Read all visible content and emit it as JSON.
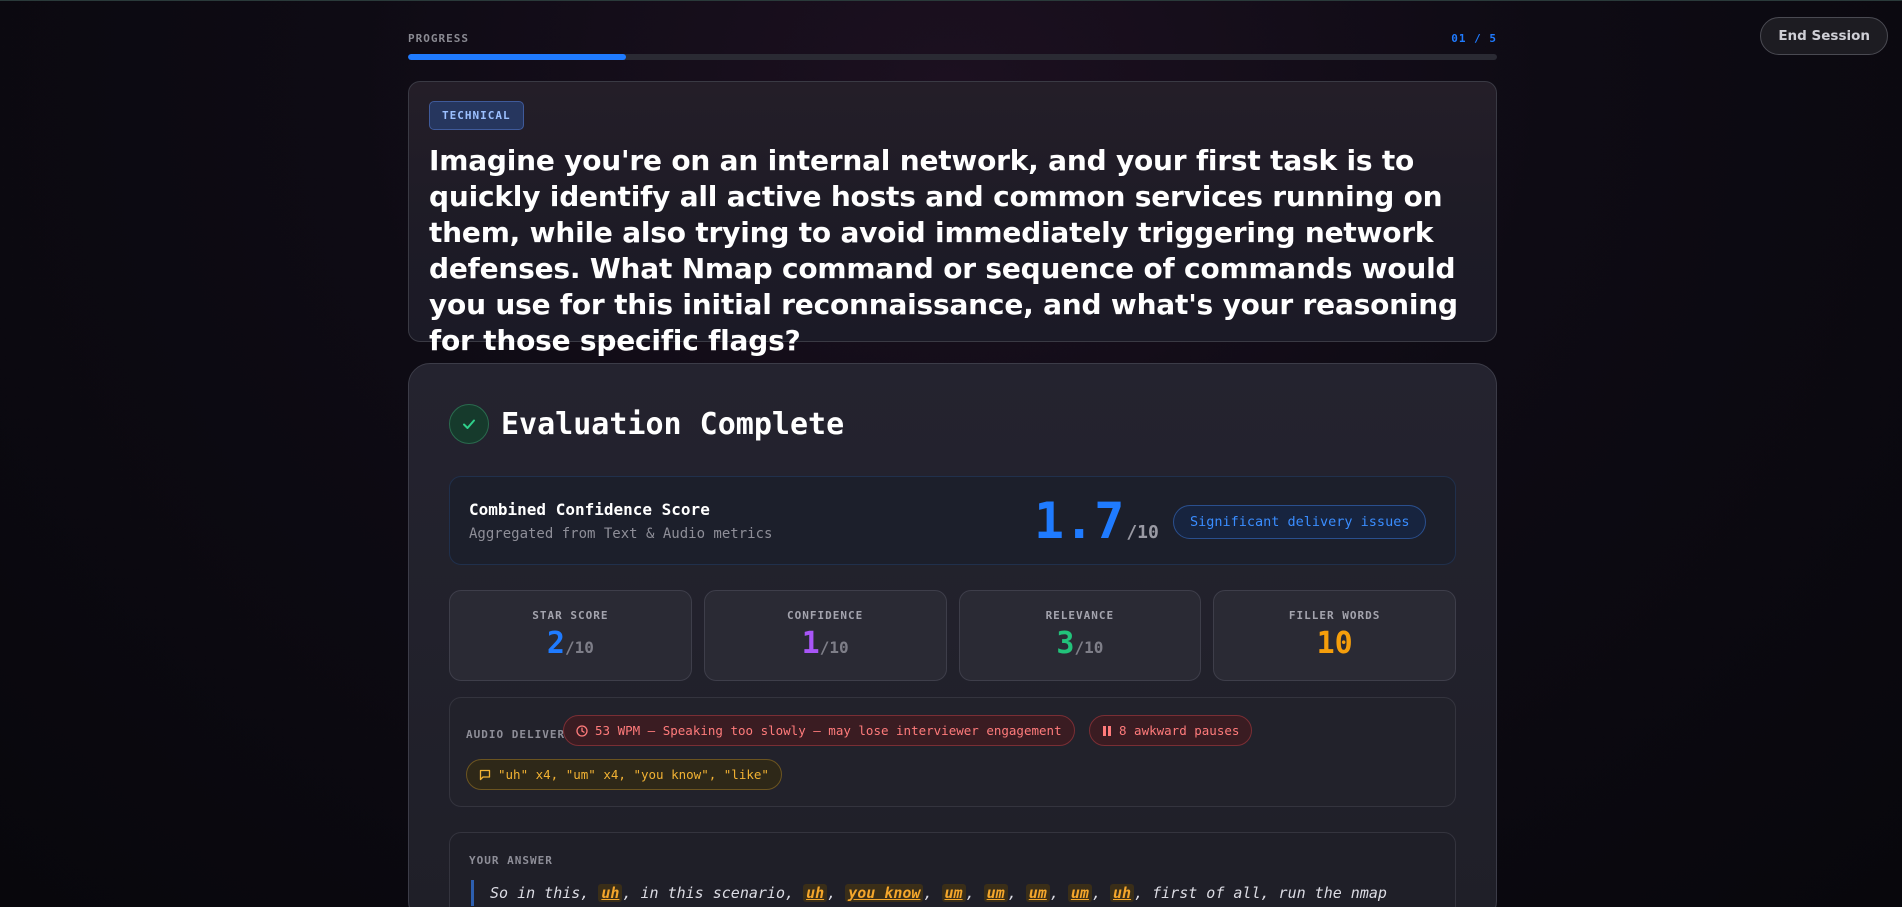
{
  "header": {
    "end_session_label": "End Session"
  },
  "progress": {
    "label": "PROGRESS",
    "count": "01 / 5",
    "fraction": 0.2
  },
  "question": {
    "tag": "TECHNICAL",
    "text": "Imagine you're on an internal network, and your first task is to quickly identify all active hosts and common services running on them, while also trying to avoid immediately triggering network defenses. What Nmap command or sequence of commands would you use for this initial reconnaissance, and what's your reasoning for those specific flags?"
  },
  "evaluation": {
    "title": "Evaluation Complete",
    "combined": {
      "title": "Combined Confidence Score",
      "subtitle": "Aggregated from Text & Audio metrics",
      "score": "1.7",
      "denominator": "/10",
      "badge": "Significant delivery issues"
    },
    "metrics": [
      {
        "label": "STAR SCORE",
        "value": "2",
        "denominator": "/10",
        "color": "#1f7bff"
      },
      {
        "label": "CONFIDENCE",
        "value": "1",
        "denominator": "/10",
        "color": "#a855f7"
      },
      {
        "label": "RELEVANCE",
        "value": "3",
        "denominator": "/10",
        "color": "#22c27a"
      },
      {
        "label": "FILLER WORDS",
        "value": "10",
        "denominator": "",
        "color": "#f59e0b"
      }
    ],
    "audio": {
      "label": "AUDIO DELIVERY",
      "pace": "53 WPM — Speaking too slowly — may lose interviewer engagement",
      "pauses": "8 awkward pauses",
      "fillers": "\"uh\" x4, \"um\" x4, \"you know\", \"like\""
    },
    "answer": {
      "label": "YOUR ANSWER",
      "segments": [
        {
          "text": "So in this, ",
          "filler": false
        },
        {
          "text": "uh",
          "filler": true
        },
        {
          "text": ", in this scenario, ",
          "filler": false
        },
        {
          "text": "uh",
          "filler": true
        },
        {
          "text": ", ",
          "filler": false
        },
        {
          "text": "you know",
          "filler": true
        },
        {
          "text": ", ",
          "filler": false
        },
        {
          "text": "um",
          "filler": true
        },
        {
          "text": ", ",
          "filler": false
        },
        {
          "text": "um",
          "filler": true
        },
        {
          "text": ", ",
          "filler": false
        },
        {
          "text": "um",
          "filler": true
        },
        {
          "text": ", ",
          "filler": false
        },
        {
          "text": "um",
          "filler": true
        },
        {
          "text": ", ",
          "filler": false
        },
        {
          "text": "uh",
          "filler": true
        },
        {
          "text": ", first of all, run the nmap",
          "filler": false
        }
      ]
    }
  }
}
